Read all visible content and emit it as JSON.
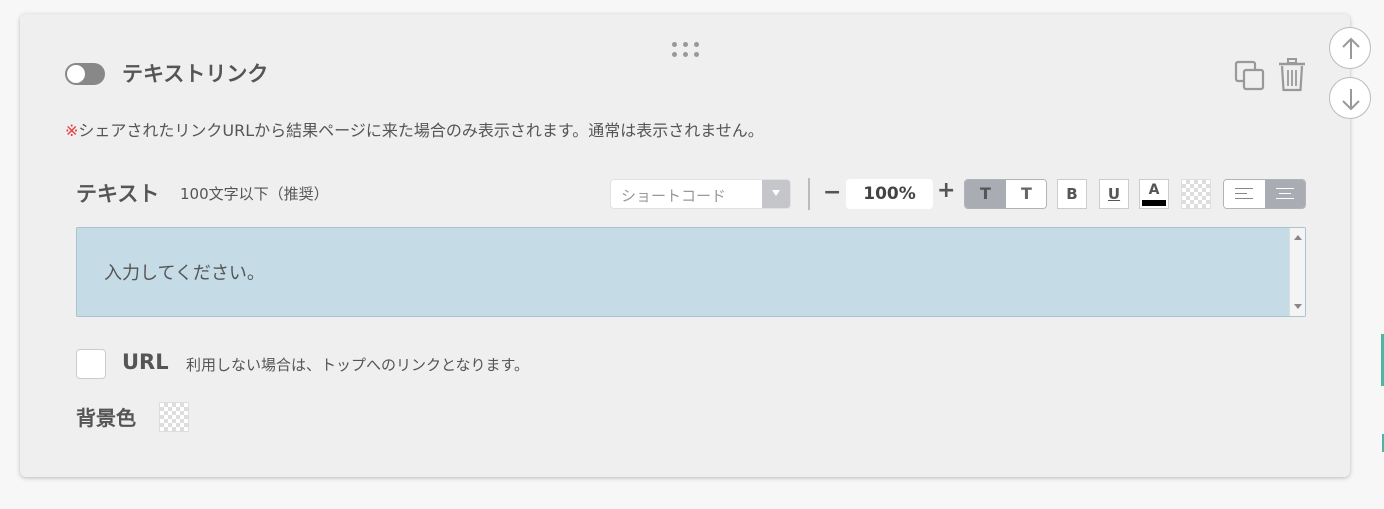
{
  "block": {
    "title": "テキストリンク",
    "note_mark": "※",
    "note_text": "シェアされたリンクURLから結果ページに来た場合のみ表示されます。通常は表示されません。"
  },
  "text_field": {
    "label": "テキスト",
    "hint": "100文字以下（推奨）",
    "placeholder": "入力してください。"
  },
  "toolbar": {
    "shortcode_select": "ショートコード",
    "minus_label": "−",
    "zoom_value": "100%",
    "plus_label": "+",
    "text_style_a": "T",
    "text_style_b": "T",
    "bold_label": "B",
    "underline_label": "U",
    "font_color_label": "A",
    "font_color": "#000000"
  },
  "url_option": {
    "label": "URL",
    "note": "利用しない場合は、トップへのリンクとなります。"
  },
  "background": {
    "label": "背景色"
  },
  "colors": {
    "card_bg": "#efefef",
    "textarea_bg": "#c5dce6",
    "note_mark": "#e53c3c",
    "accent": "#4fb3a8"
  }
}
